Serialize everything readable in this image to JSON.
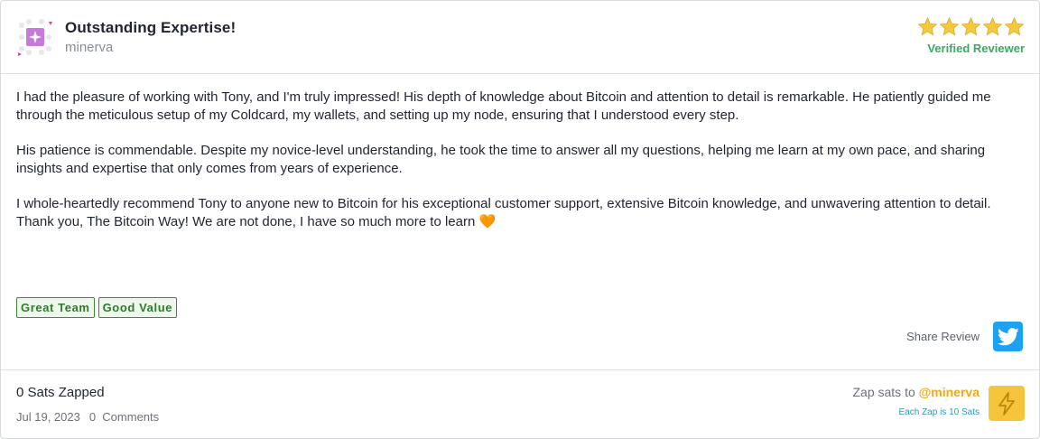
{
  "review": {
    "title": "Outstanding Expertise!",
    "username": "minerva",
    "rating": 5,
    "rating_max": 5,
    "verified_label": "Verified Reviewer",
    "paragraphs": [
      "I had the pleasure of working with Tony, and I'm truly impressed! His depth of knowledge about Bitcoin and attention to detail is remarkable. He patiently guided me through the meticulous setup of my Coldcard, my wallets, and setting up my node, ensuring that I understood every step.",
      "His patience is commendable. Despite my novice-level understanding, he took the time to answer all my questions, helping me learn at my own pace, and sharing insights and expertise that only comes from years of experience.",
      "I whole-heartedly recommend Tony to anyone new to Bitcoin for his exceptional customer support, extensive Bitcoin knowledge, and unwavering attention to detail. Thank you, The Bitcoin Way! We are not done, I have so much more to learn"
    ],
    "emoji": "🧡",
    "tags": [
      "Great Team",
      "Good Value"
    ],
    "share_label": "Share Review"
  },
  "footer": {
    "sats_zapped": "0 Sats Zapped",
    "date": "Jul 19, 2023",
    "comments": "0  Comments",
    "zap_prefix": "Zap sats to",
    "zap_user": "@minerva",
    "zap_note": "Each Zap is 10 Sats"
  },
  "icons": {
    "avatar": "avatar-icon",
    "star": "star-icon",
    "share": "twitter-icon",
    "zap": "lightning-bolt-icon"
  },
  "colors": {
    "star": "#f5c840",
    "verified": "#3ca860",
    "tag_border": "#3d8a3a",
    "twitter": "#1da1f2",
    "zap_button": "#f5c43a",
    "zap_user": "#f0a915"
  }
}
